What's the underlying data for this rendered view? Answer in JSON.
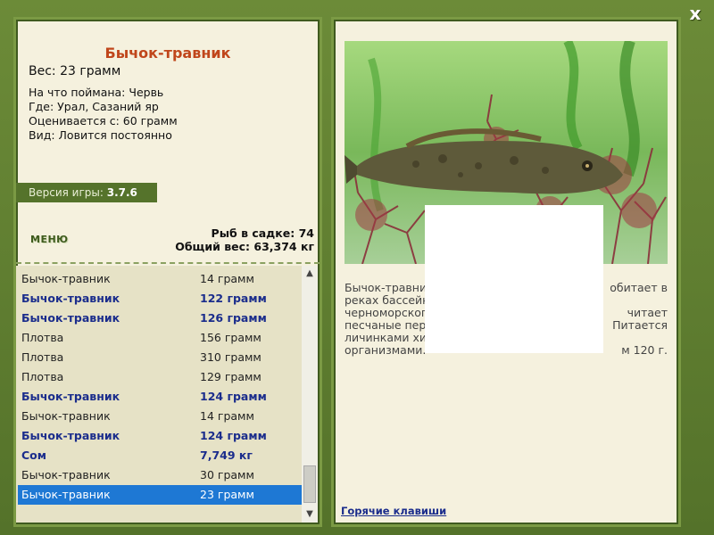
{
  "close_label": "x",
  "fish": {
    "title": "Бычок-травник",
    "weight": "Вес: 23 грамм",
    "info": [
      "На что поймана: Червь",
      "Где: Урал, Сазаний яр",
      "Оценивается с: 60 грамм",
      "Вид: Ловится постоянно"
    ]
  },
  "version": {
    "label": "Версия игры:",
    "value": "3.7.6"
  },
  "menu_label": "МЕНЮ",
  "stats": {
    "fish_in_cage": "Рыб в садке: 74",
    "total_weight": "Общий вес: 63,374 кг"
  },
  "catch_list": [
    {
      "name": "Бычок-травник",
      "weight": "14 грамм",
      "highlight": false
    },
    {
      "name": "Бычок-травник",
      "weight": "122 грамм",
      "highlight": true
    },
    {
      "name": "Бычок-травник",
      "weight": "126 грамм",
      "highlight": true
    },
    {
      "name": "Плотва",
      "weight": "156 грамм",
      "highlight": false
    },
    {
      "name": "Плотва",
      "weight": "310 грамм",
      "highlight": false
    },
    {
      "name": "Плотва",
      "weight": "129 грамм",
      "highlight": false
    },
    {
      "name": "Бычок-травник",
      "weight": "124 грамм",
      "highlight": true
    },
    {
      "name": "Бычок-травник",
      "weight": "14 грамм",
      "highlight": false
    },
    {
      "name": "Бычок-травник",
      "weight": "124 грамм",
      "highlight": true
    },
    {
      "name": "Сом",
      "weight": "7,749 кг",
      "highlight": true
    },
    {
      "name": "Бычок-травник",
      "weight": "30 грамм",
      "highlight": false
    },
    {
      "name": "Бычок-травник",
      "weight": "23 грамм",
      "highlight": false,
      "selected": true
    }
  ],
  "description": [
    {
      "left": "Бычок-травни",
      "right": "обитает в"
    },
    {
      "left": "реках бассейн",
      "right": ""
    },
    {
      "left": "черноморског",
      "right": "читает"
    },
    {
      "left": "песчаные пер",
      "right": "Питается"
    },
    {
      "left": "  личинками хи",
      "right": ""
    },
    {
      "left": "организмами.",
      "right": "м 120 г."
    }
  ],
  "hotkeys_label": "Горячие клавиши",
  "colors": {
    "title": "#c0461b",
    "highlight": "#1b2d8c",
    "selected": "#1e78d4",
    "frame": "#5a7a2e"
  }
}
